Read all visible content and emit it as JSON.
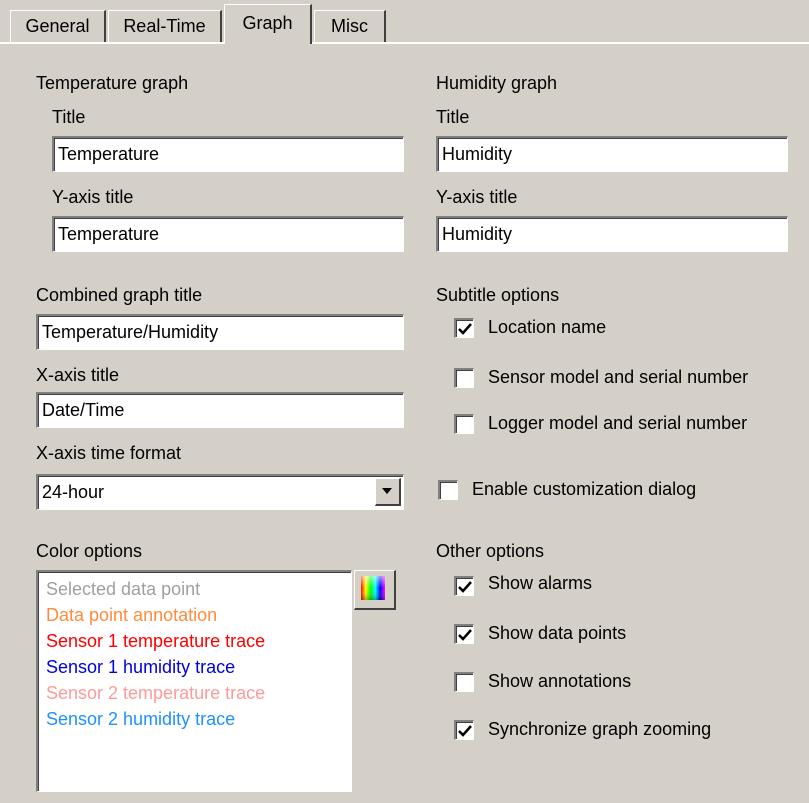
{
  "tabs": [
    {
      "label": "General"
    },
    {
      "label": "Real-Time"
    },
    {
      "label": "Graph"
    },
    {
      "label": "Misc"
    }
  ],
  "temperature_graph": {
    "heading": "Temperature graph",
    "title_label": "Title",
    "title_value": "Temperature",
    "yaxis_label": "Y-axis title",
    "yaxis_value": "Temperature"
  },
  "humidity_graph": {
    "heading": "Humidity graph",
    "title_label": "Title",
    "title_value": "Humidity",
    "yaxis_label": "Y-axis title",
    "yaxis_value": "Humidity"
  },
  "combined": {
    "title_label": "Combined graph title",
    "title_value": "Temperature/Humidity",
    "xaxis_label": "X-axis title",
    "xaxis_value": "Date/Time",
    "time_format_label": "X-axis time format",
    "time_format_value": "24-hour"
  },
  "subtitle_options": {
    "heading": "Subtitle options",
    "items": [
      {
        "label": "Location name",
        "checked": true
      },
      {
        "label": "Sensor model and serial number",
        "checked": false
      },
      {
        "label": "Logger model and serial number",
        "checked": false
      }
    ]
  },
  "customization": {
    "label": "Enable customization dialog",
    "checked": false
  },
  "color_options": {
    "heading": "Color options",
    "items": [
      {
        "label": "Selected data point",
        "color": "#a0a0a0"
      },
      {
        "label": "Data point annotation",
        "color": "#ff8c3c"
      },
      {
        "label": "Sensor 1 temperature trace",
        "color": "#ff0000"
      },
      {
        "label": "Sensor 1 humidity trace",
        "color": "#0000e0"
      },
      {
        "label": "Sensor 2 temperature trace",
        "color": "#ff9a9a"
      },
      {
        "label": "Sensor 2 humidity trace",
        "color": "#1e90ff"
      }
    ],
    "picker_icon": "color-palette-icon"
  },
  "other_options": {
    "heading": "Other options",
    "items": [
      {
        "label": "Show alarms",
        "checked": true
      },
      {
        "label": "Show data points",
        "checked": true
      },
      {
        "label": "Show annotations",
        "checked": false
      },
      {
        "label": "Synchronize graph zooming",
        "checked": true
      }
    ]
  }
}
